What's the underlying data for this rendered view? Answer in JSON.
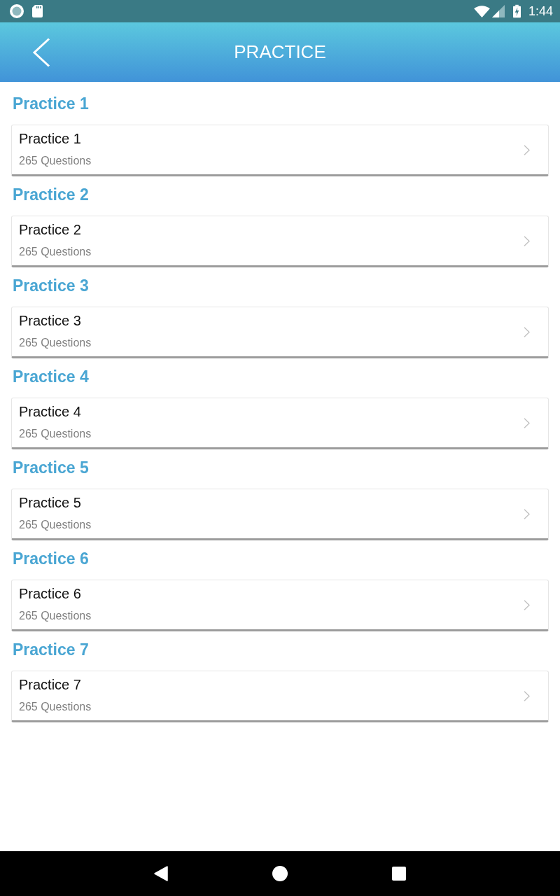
{
  "status_bar": {
    "time": "1:44"
  },
  "header": {
    "title": "PRACTICE"
  },
  "sections": [
    {
      "heading": "Practice 1",
      "card": {
        "title": "Practice 1",
        "subtitle": "265 Questions"
      }
    },
    {
      "heading": "Practice 2",
      "card": {
        "title": "Practice 2",
        "subtitle": "265 Questions"
      }
    },
    {
      "heading": "Practice 3",
      "card": {
        "title": "Practice 3",
        "subtitle": "265 Questions"
      }
    },
    {
      "heading": "Practice 4",
      "card": {
        "title": "Practice 4",
        "subtitle": "265 Questions"
      }
    },
    {
      "heading": "Practice 5",
      "card": {
        "title": "Practice 5",
        "subtitle": "265 Questions"
      }
    },
    {
      "heading": "Practice 6",
      "card": {
        "title": "Practice 6",
        "subtitle": "265 Questions"
      }
    },
    {
      "heading": "Practice 7",
      "card": {
        "title": "Practice 7",
        "subtitle": "265 Questions"
      }
    }
  ]
}
